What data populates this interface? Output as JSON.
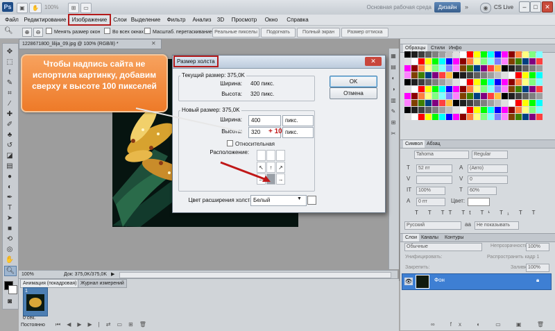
{
  "titlebar": {
    "app_logo": "Ps",
    "zoom": "100%",
    "workspace_label": "Основная рабочая среда",
    "workspace_button": "Дизайн",
    "cs_live": "CS Live"
  },
  "menu": [
    "Файл",
    "Редактирование",
    "Изображение",
    "Слои",
    "Выделение",
    "Фильтр",
    "Анализ",
    "3D",
    "Просмотр",
    "Окно",
    "Справка"
  ],
  "options_bar": {
    "resize_windows": "Менять размер окон",
    "all_windows": "Во всех окнах",
    "scrubby_zoom": "Масштаб. перетаскиванием",
    "actual_pixels": "Реальные пикселы",
    "fit_screen": "Подогнать",
    "fill_screen": "Полный экран",
    "print_size": "Размер оттиска"
  },
  "document": {
    "tab_title": "1228671800_lilija_09.jpg @ 100% (RGB/8) *",
    "zoom": "100%",
    "doc_info": "Док: 375,0K/375,0K"
  },
  "animation_panel": {
    "tab_animation": "Анимация (покадровая)",
    "tab_measure": "Журнал измерений",
    "frame_number": "1",
    "frame_time": "0 сек.",
    "loop": "Постоянно"
  },
  "dialog": {
    "title": "Размер холста",
    "current_size_label": "Текущий размер: 375,0K",
    "width_label": "Ширина:",
    "width_value": "400 пикс.",
    "height_label": "Высота:",
    "height_value": "320 пикс.",
    "new_size_label": "Новый размер: 375,0K",
    "new_width": "400",
    "new_width_unit": "пикс.",
    "new_height": "320",
    "new_height_annotation": "+ 100",
    "new_height_unit": "пикс.",
    "relative": "Относительная",
    "anchor_label": "Расположение:",
    "canvas_color_label": "Цвет расширения холста:",
    "canvas_color_value": "Белый",
    "ok": "OK",
    "cancel": "Отмена"
  },
  "callout": {
    "text": "Чтобы надпись сайта не испортила картинку, добавим сверху к высоте 100 пикселей"
  },
  "swatches_panel": {
    "tabs": [
      "Образцы",
      "Стили",
      "Инфо"
    ],
    "colors": [
      "#000000",
      "#1f1f1f",
      "#3f3f3f",
      "#5f5f5f",
      "#7f7f7f",
      "#9f9f9f",
      "#bfbfbf",
      "#dfdfdf",
      "#ffffff",
      "#ff0000",
      "#ffff00",
      "#00ff00",
      "#00ffff",
      "#0000ff",
      "#ff00ff",
      "#8b0000",
      "#ff8040",
      "#ffff80",
      "#80ff80",
      "#80ffff",
      "#8080ff",
      "#ff80ff",
      "#804000",
      "#408000",
      "#004080",
      "#800080",
      "#ff4040",
      "#ffc040"
    ]
  },
  "character_panel": {
    "tabs": [
      "Символ",
      "Абзац"
    ],
    "font": "Tahoma",
    "style": "Regular",
    "size": "52 пт",
    "leading": "(Авто)",
    "tracking": "0",
    "vscale": "100%",
    "hscale": "60%",
    "baseline": "0 пт",
    "color_label": "Цвет:",
    "language": "Русский",
    "antialias": "Не показывать"
  },
  "layers_panel": {
    "tabs": [
      "Слои",
      "Каналы",
      "Контуры"
    ],
    "blend_mode": "Обычные",
    "opacity_label": "Непрозрачность:",
    "opacity": "100%",
    "unify_label": "Унифицировать:",
    "propagate": "Распространить кадр 1",
    "lock_label": "Закрепить:",
    "fill_label": "Заливка:",
    "fill": "100%",
    "layer_name": "Фон"
  }
}
